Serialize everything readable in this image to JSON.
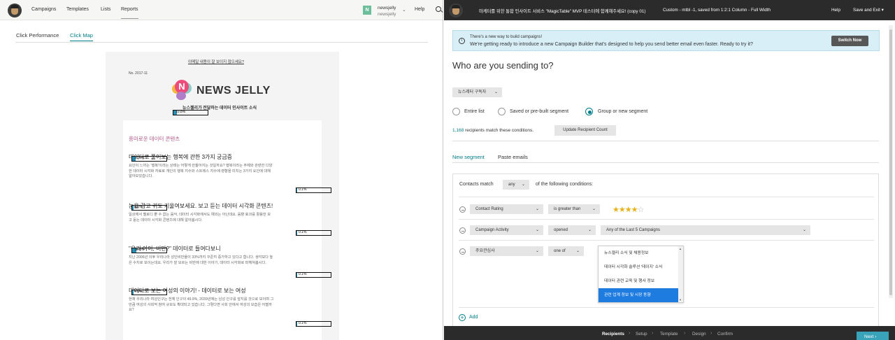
{
  "left": {
    "nav": {
      "items": [
        "Campaigns",
        "Templates",
        "Lists",
        "Reports"
      ],
      "active": "Reports",
      "avatar_letter": "N",
      "user_name": "newsjelly",
      "user_account": "newsjelly",
      "help": "Help"
    },
    "tabs": [
      "Click Performance",
      "Click Map"
    ],
    "active_tab": "Click Map",
    "email": {
      "view_online": "이메일 내용이 잘 보이지 않으세요?",
      "issue_no": "No. 2017-11",
      "logo_letter": "N",
      "logo_text": "NEWS JELLY",
      "subtitle": "뉴스젤리가 전달하는 데이터 인사이트 소식",
      "section_title": "흥미로운 데이터 콘텐츠",
      "articles": [
        {
          "title": "데이터로 풀어보는 행복에 관한 3가지 궁금증",
          "body_lines": [
            "요인이 느끼는 '행복'이라는 상태는 어떻게 만들어지는 것일까요? 행복이라는 주제와 관련한 다양",
            "한 데이터 시각화 자료로 개인의 행복 지수와 스트레스 지수에 영향을 미치는 3가지 요인에 대해",
            "알아보았습니다."
          ]
        },
        {
          "title": "눈을 감고 귀도 기울여보세요. 보고 듣는 데이터 시각화 콘텐츠!",
          "body_lines": [
            "일상에서 멜로디 뿐 수 없는 음악, 데이터 시각화에서도 예외는 아닌데요. 음향 효과를 활용한 보",
            "고 듣는 데이터 시각화 콘텐츠에 대해 알아봅시다."
          ]
        },
        {
          "title": "\"우리 아이, 비만?\" 데이터로 들여다보니",
          "body_lines": [
            "지난 2006년 이후 우리나라 성인비만율이 33%까지 꾸준히 증가하고 있다고 합니다. 생각보다 높",
            "은 수치로 보이는데요. 우리가 잘 모르는 비만에 대한 이야기, 데이터 시각화로 파헤쳐봅시다."
          ]
        },
        {
          "title": "데이터로 보는 여성의 이야기! - 데이터로 보는 여성",
          "body_lines": [
            "현재 우리나라 여성인구는 전체 인구의 49.9%, 2039년에는 남성 인구를 앞지를 것으로 보이며 그",
            "만큼 여성의 사회적 참여 규모도 확대되고 있습니다. 그렇다면 사회 안에서 여성의 모습은 어떨까",
            "요?"
          ]
        }
      ],
      "click_pcts": [
        {
          "label": "10.8%",
          "fraction": 0.108
        },
        {
          "label": "10.6%",
          "fraction": 0.106
        },
        {
          "label": "0.1%",
          "fraction": 0.001
        },
        {
          "label": "4.6%",
          "fraction": 0.046
        },
        {
          "label": "0.1%",
          "fraction": 0.001
        },
        {
          "label": "12.8%",
          "fraction": 0.128
        },
        {
          "label": "0.1%",
          "fraction": 0.001
        },
        {
          "label": "4.6%",
          "fraction": 0.046
        },
        {
          "label": "0.1%",
          "fraction": 0.001
        }
      ]
    }
  },
  "right": {
    "header": {
      "campaign_title": "마케터를 위한 통합 인사이트 서비스 \"MagicTable\" MVP 테스터에 함께해주세요! (copy 01)",
      "template_info": "Custom - mtbl -1, saved from 1:2:1 Column - Full Width",
      "help": "Help",
      "save_exit": "Save and Exit",
      "save_exit_chevron": "▾"
    },
    "notice": {
      "icon": "i",
      "line1": "There's a new way to build campaigns!",
      "line2": "We're getting ready to introduce a new Campaign Builder that's designed to help you send better email even faster. Ready to try it?",
      "button": "Switch Now"
    },
    "heading": "Who are you sending to?",
    "list_select": "뉴스레터 구독자",
    "radios": [
      {
        "label": "Entire list",
        "checked": false
      },
      {
        "label": "Saved or pre-built segment",
        "checked": false
      },
      {
        "label": "Group or new segment",
        "checked": true
      }
    ],
    "recipients": {
      "count": "1,168",
      "text": "recipients match these conditions.",
      "button": "Update Recipient Count"
    },
    "seg_tabs": [
      "New segment",
      "Paste emails"
    ],
    "active_seg_tab": "New segment",
    "match": {
      "prefix": "Contacts match",
      "value": "any",
      "suffix": "of the following conditions:"
    },
    "conditions": [
      {
        "field": "Contact Rating",
        "operator": "is greater than",
        "rating": 4,
        "rating_max": 5
      },
      {
        "field": "Campaign Activity",
        "operator": "opened",
        "value": "Any of the Last 5 Campaigns"
      },
      {
        "field": "주요관심사",
        "operator": "one of"
      }
    ],
    "interest_options": [
      {
        "label": "뉴스젤리 소식 및 채용정보",
        "selected": false
      },
      {
        "label": "데이터 시각화 솔루션 '데이지' 소식",
        "selected": false
      },
      {
        "label": "데이터 관련 교육 및 행사 정보",
        "selected": false
      },
      {
        "label": "관련 업계 정보 및 시장 동향",
        "selected": true
      }
    ],
    "add_label": "Add",
    "footer": {
      "steps": [
        "Recipients",
        "Setup",
        "Template",
        "Design",
        "Confirm"
      ],
      "active_step": "Recipients",
      "next": "Next"
    },
    "colors": {
      "accent": "#007c89",
      "header_bg": "#2b2b2b",
      "notice_bg": "#d9eff7",
      "star": "#e8b11a",
      "selected_option": "#1e7be0",
      "next_button": "#39a3b9",
      "click_fill": "#2a8fb5",
      "section_title": "#b0588a"
    }
  }
}
